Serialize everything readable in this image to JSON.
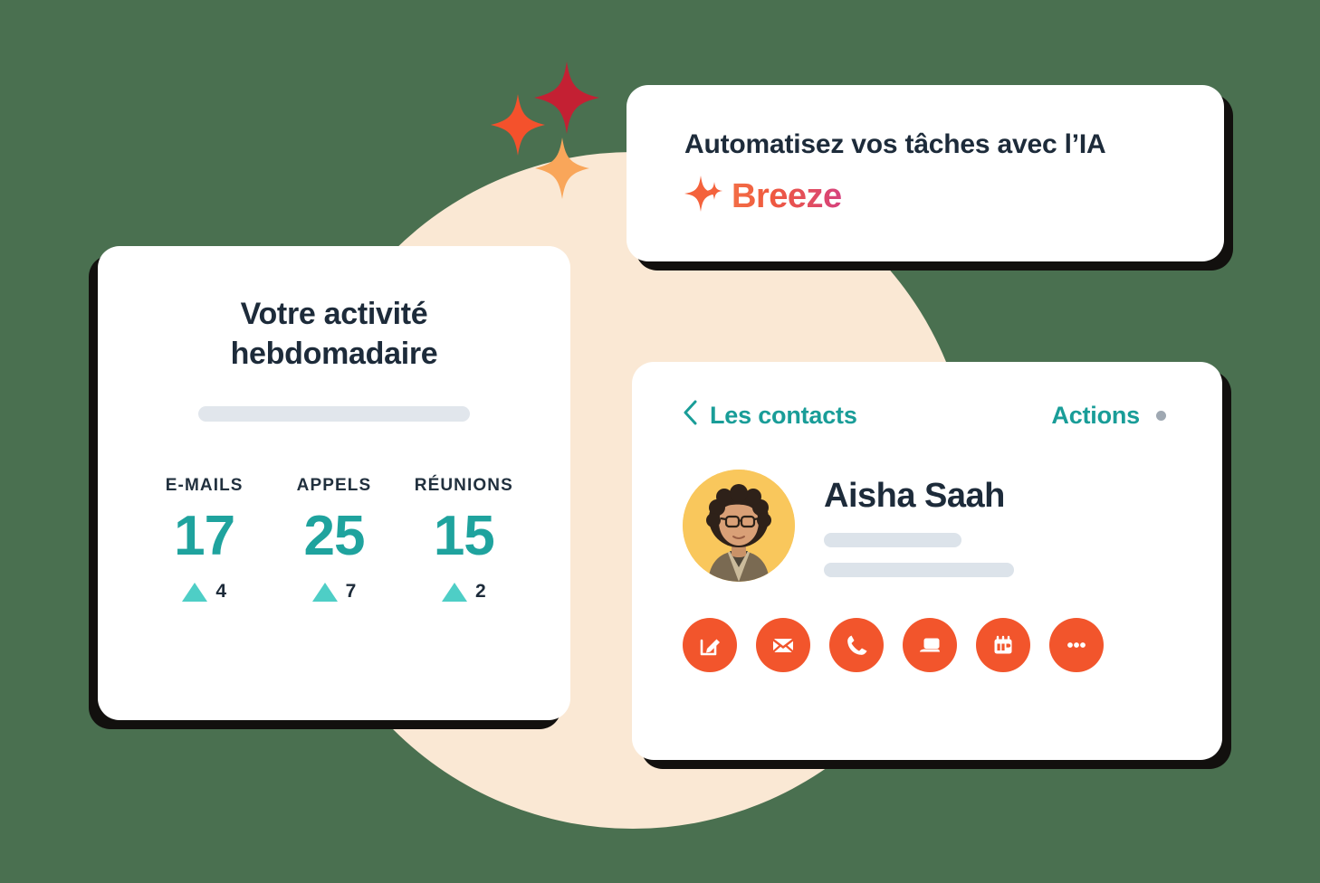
{
  "theme": {
    "background_green": "#4A7050",
    "circle_cream": "#FAE8D4",
    "card_white": "#FFFFFF",
    "shadow_black": "#12100E",
    "teal": "#1FA39E",
    "teal_link": "#199D98",
    "teal_light": "#4ECEC6",
    "navy": "#1D2B3A",
    "orange": "#F2552C",
    "placeholder_gray": "#E1E6EC",
    "avatar_yellow": "#F9C75C",
    "dot_gray": "#9FA8B2"
  },
  "decorations": {
    "sparkles": [
      {
        "name": "sparkle-dark-red",
        "color": "#C42033"
      },
      {
        "name": "sparkle-orange",
        "color": "#F4512C"
      },
      {
        "name": "sparkle-peach",
        "color": "#F9A65A"
      }
    ]
  },
  "ai_card": {
    "title": "Automatisez vos tâches avec l’IA",
    "brand_name": "Breeze",
    "brand_icon": "sparkle-icon",
    "brand_gradient_from": "#F26E47",
    "brand_gradient_to": "#D6417E"
  },
  "activity_card": {
    "title": "Votre activité hebdomadaire",
    "placeholder_bar": "",
    "stats": [
      {
        "label": "E-MAILS",
        "value": "17",
        "delta": "4",
        "delta_direction": "up"
      },
      {
        "label": "APPELS",
        "value": "25",
        "delta": "7",
        "delta_direction": "up"
      },
      {
        "label": "RÉUNIONS",
        "value": "15",
        "delta": "2",
        "delta_direction": "up"
      }
    ]
  },
  "contacts_card": {
    "back_label": "Les contacts",
    "back_icon": "chevron-left-icon",
    "actions_label": "Actions",
    "actions_dot": "status-dot",
    "contact": {
      "name": "Aisha Saah",
      "avatar_alt": "woman-with-curly-hair-and-glasses",
      "detail_line_1": "",
      "detail_line_2": ""
    },
    "action_buttons": [
      {
        "name": "note-button",
        "icon": "edit-note-icon"
      },
      {
        "name": "email-button",
        "icon": "envelope-icon"
      },
      {
        "name": "call-button",
        "icon": "phone-icon"
      },
      {
        "name": "meeting-button",
        "icon": "laptop-icon"
      },
      {
        "name": "schedule-button",
        "icon": "calendar-icon"
      },
      {
        "name": "more-button",
        "icon": "ellipsis-icon"
      }
    ]
  }
}
